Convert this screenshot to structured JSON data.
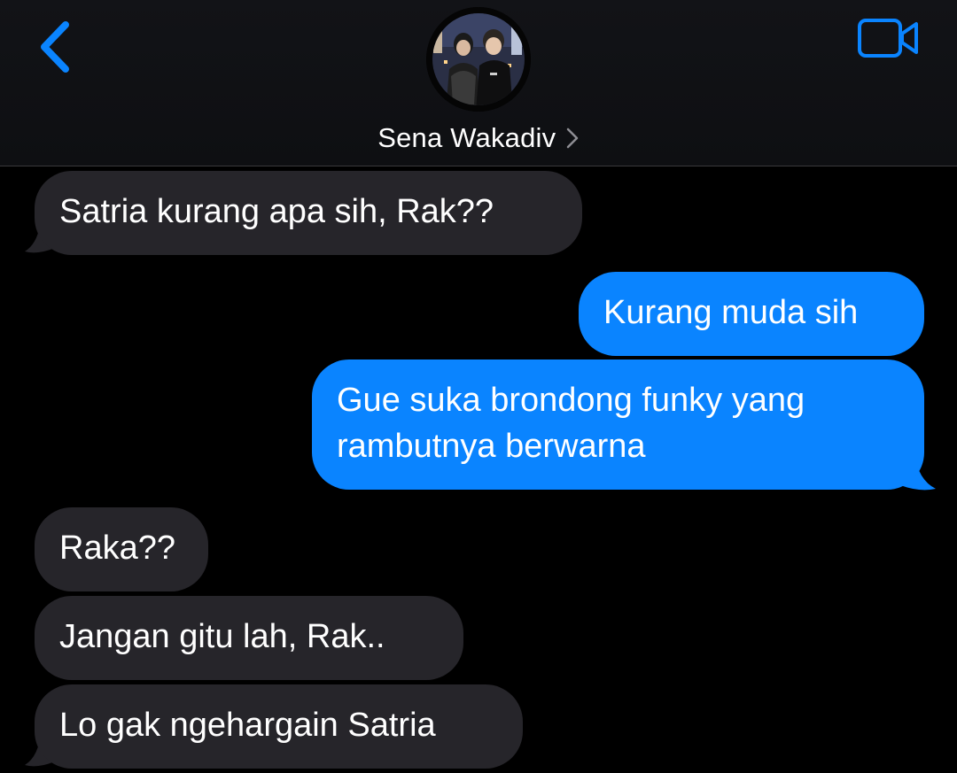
{
  "header": {
    "contact_name": "Sena Wakadiv",
    "back_icon": "chevron-left-icon",
    "video_icon": "video-camera-icon",
    "accent_color": "#0a84ff"
  },
  "messages": [
    {
      "direction": "received",
      "text": "Satria kurang apa sih, Rak??"
    },
    {
      "direction": "sent",
      "text": "Kurang muda sih"
    },
    {
      "direction": "sent",
      "lines": [
        "Gue suka brondong funky yang",
        "rambutnya berwarna"
      ]
    },
    {
      "direction": "received",
      "text": "Raka??"
    },
    {
      "direction": "received",
      "text": "Jangan gitu lah, Rak.."
    },
    {
      "direction": "received",
      "text": "Lo gak ngehargain Satria"
    }
  ],
  "colors": {
    "received_bubble": "#26252a",
    "sent_bubble": "#0a84ff",
    "background": "#000000"
  }
}
